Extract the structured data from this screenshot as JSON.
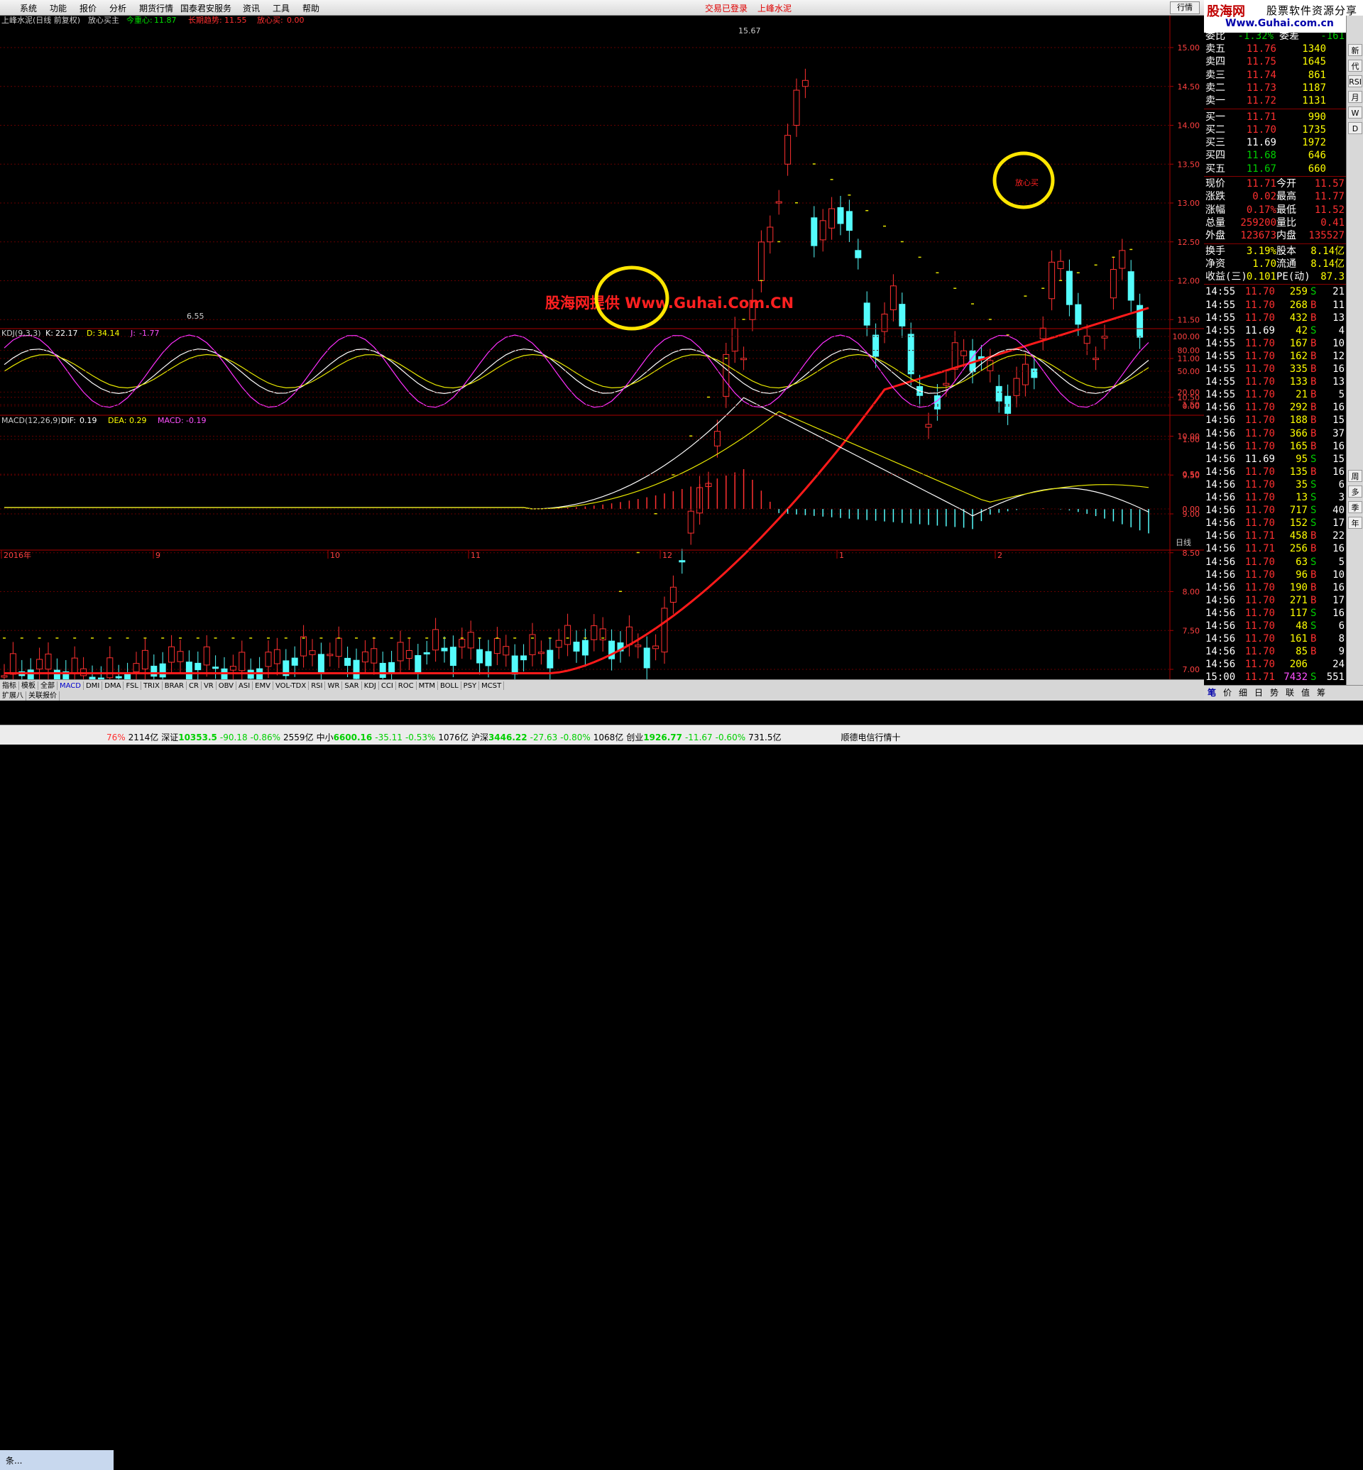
{
  "menu": [
    "系统",
    "功能",
    "报价",
    "分析",
    "期货行情",
    "国泰君安服务",
    "资讯",
    "工具",
    "帮助"
  ],
  "title_center": "交易已登录",
  "title_stock": "上峰水泥",
  "return_btn": "行情",
  "logo": {
    "brand": "股海网",
    "slogan": "股票软件资源分享",
    "url": "Www.Guhai.com.cn"
  },
  "main_header": {
    "name": "上峰水泥(日线 前复权)",
    "indicator": "放心买主",
    "l1": "今重心:",
    "v1": "11.87",
    "l2": "长期趋势:",
    "v2": "11.55",
    "l3": "放心买:",
    "v3": "0.00"
  },
  "price_axis": [
    "15.00",
    "14.50",
    "14.00",
    "13.50",
    "13.00",
    "12.50",
    "12.00",
    "11.50",
    "11.00",
    "10.50",
    "10.00",
    "9.50",
    "9.00",
    "8.50",
    "8.00",
    "7.50",
    "7.00"
  ],
  "annotations": {
    "high": "15.67",
    "low": "6.55",
    "signal": "放心买",
    "watermark": "股海网提供 Www.Guhai.Com.CN"
  },
  "kdj": {
    "name": "KDJ(9,3,3)",
    "k_label": "K:",
    "k": "22.17",
    "d_label": "D:",
    "d": "34.14",
    "j_label": "J:",
    "j": "-1.77",
    "axis": [
      "100.00",
      "80.00",
      "50.00",
      "20.00",
      "0.00"
    ]
  },
  "macd": {
    "name": "MACD(12,26,9)",
    "dif_label": "DIF:",
    "dif": "0.19",
    "dea_label": "DEA:",
    "dea": "0.29",
    "macd_label": "MACD:",
    "macd": "-0.19",
    "axis": [
      "1.50",
      "1.00",
      "0.50",
      "0.00"
    ]
  },
  "date_axis": [
    "2016年",
    "9",
    "10",
    "11",
    "12",
    "1",
    "2"
  ],
  "period": "日线",
  "tabs": [
    "指标",
    "模板",
    "全部",
    "MACD",
    "DMI",
    "DMA",
    "FSL",
    "TRIX",
    "BRAR",
    "CR",
    "VR",
    "OBV",
    "ASI",
    "EMV",
    "VOL-TDX",
    "RSI",
    "WR",
    "SAR",
    "KDJ",
    "CCI",
    "ROC",
    "MTM",
    "BOLL",
    "PSY",
    "MCST"
  ],
  "tabs2": [
    "扩展八",
    "关联报价"
  ],
  "quote": {
    "weibi": {
      "l": "委比",
      "v": "-1.32%",
      "l2": "委差",
      "v2": "-161"
    },
    "sell": [
      {
        "l": "卖五",
        "p": "11.76",
        "v": "1340"
      },
      {
        "l": "卖四",
        "p": "11.75",
        "v": "1645"
      },
      {
        "l": "卖三",
        "p": "11.74",
        "v": "861"
      },
      {
        "l": "卖二",
        "p": "11.73",
        "v": "1187"
      },
      {
        "l": "卖一",
        "p": "11.72",
        "v": "1131"
      }
    ],
    "buy": [
      {
        "l": "买一",
        "p": "11.71",
        "v": "990"
      },
      {
        "l": "买二",
        "p": "11.70",
        "v": "1735"
      },
      {
        "l": "买三",
        "p": "11.69",
        "v": "1972"
      },
      {
        "l": "买四",
        "p": "11.68",
        "v": "646"
      },
      {
        "l": "买五",
        "p": "11.67",
        "v": "660"
      }
    ],
    "stats": [
      {
        "l": "现价",
        "v": "11.71",
        "l2": "今开",
        "v2": "11.57"
      },
      {
        "l": "涨跌",
        "v": "0.02",
        "l2": "最高",
        "v2": "11.77"
      },
      {
        "l": "涨幅",
        "v": "0.17%",
        "l2": "最低",
        "v2": "11.52"
      },
      {
        "l": "总量",
        "v": "259200",
        "l2": "量比",
        "v2": "0.41"
      },
      {
        "l": "外盘",
        "v": "123673",
        "l2": "内盘",
        "v2": "135527"
      }
    ],
    "stats2": [
      {
        "l": "换手",
        "v": "3.19%",
        "l2": "股本",
        "v2": "8.14亿"
      },
      {
        "l": "净资",
        "v": "1.70",
        "l2": "流通",
        "v2": "8.14亿"
      },
      {
        "l": "收益(三)",
        "v": "0.101",
        "l2": "PE(动)",
        "v2": "87.3"
      }
    ],
    "ticks": [
      {
        "t": "14:55",
        "p": "11.70",
        "v": "259",
        "s": "S",
        "n": "21"
      },
      {
        "t": "14:55",
        "p": "11.70",
        "v": "268",
        "s": "B",
        "n": "11"
      },
      {
        "t": "14:55",
        "p": "11.70",
        "v": "432",
        "s": "B",
        "n": "13"
      },
      {
        "t": "14:55",
        "p": "11.69",
        "v": "42",
        "s": "S",
        "n": "4"
      },
      {
        "t": "14:55",
        "p": "11.70",
        "v": "167",
        "s": "B",
        "n": "10"
      },
      {
        "t": "14:55",
        "p": "11.70",
        "v": "162",
        "s": "B",
        "n": "12"
      },
      {
        "t": "14:55",
        "p": "11.70",
        "v": "335",
        "s": "B",
        "n": "16"
      },
      {
        "t": "14:55",
        "p": "11.70",
        "v": "133",
        "s": "B",
        "n": "13"
      },
      {
        "t": "14:55",
        "p": "11.70",
        "v": "21",
        "s": "B",
        "n": "5"
      },
      {
        "t": "14:56",
        "p": "11.70",
        "v": "292",
        "s": "B",
        "n": "16"
      },
      {
        "t": "14:56",
        "p": "11.70",
        "v": "188",
        "s": "B",
        "n": "15"
      },
      {
        "t": "14:56",
        "p": "11.70",
        "v": "366",
        "s": "B",
        "n": "37"
      },
      {
        "t": "14:56",
        "p": "11.70",
        "v": "165",
        "s": "B",
        "n": "16"
      },
      {
        "t": "14:56",
        "p": "11.69",
        "v": "95",
        "s": "S",
        "n": "15"
      },
      {
        "t": "14:56",
        "p": "11.70",
        "v": "135",
        "s": "B",
        "n": "16"
      },
      {
        "t": "14:56",
        "p": "11.70",
        "v": "35",
        "s": "S",
        "n": "6"
      },
      {
        "t": "14:56",
        "p": "11.70",
        "v": "13",
        "s": "S",
        "n": "3"
      },
      {
        "t": "14:56",
        "p": "11.70",
        "v": "717",
        "s": "S",
        "n": "40"
      },
      {
        "t": "14:56",
        "p": "11.70",
        "v": "152",
        "s": "S",
        "n": "17"
      },
      {
        "t": "14:56",
        "p": "11.71",
        "v": "458",
        "s": "B",
        "n": "22"
      },
      {
        "t": "14:56",
        "p": "11.71",
        "v": "256",
        "s": "B",
        "n": "16"
      },
      {
        "t": "14:56",
        "p": "11.70",
        "v": "63",
        "s": "S",
        "n": "5"
      },
      {
        "t": "14:56",
        "p": "11.70",
        "v": "96",
        "s": "B",
        "n": "10"
      },
      {
        "t": "14:56",
        "p": "11.70",
        "v": "190",
        "s": "B",
        "n": "16"
      },
      {
        "t": "14:56",
        "p": "11.70",
        "v": "271",
        "s": "B",
        "n": "17"
      },
      {
        "t": "14:56",
        "p": "11.70",
        "v": "117",
        "s": "S",
        "n": "16"
      },
      {
        "t": "14:56",
        "p": "11.70",
        "v": "48",
        "s": "S",
        "n": "6"
      },
      {
        "t": "14:56",
        "p": "11.70",
        "v": "161",
        "s": "B",
        "n": "8"
      },
      {
        "t": "14:56",
        "p": "11.70",
        "v": "85",
        "s": "B",
        "n": "9"
      },
      {
        "t": "14:56",
        "p": "11.70",
        "v": "206",
        "s": "",
        "n": "24"
      },
      {
        "t": "15:00",
        "p": "11.71",
        "v": "7432",
        "s": "S",
        "n": "551"
      }
    ]
  },
  "rtabs": [
    "笔",
    "价",
    "细",
    "日",
    "势",
    "联",
    "值",
    "筹"
  ],
  "vtools": [
    "新",
    "代",
    "RSI",
    "月",
    "W",
    "D",
    "周",
    "多",
    "季",
    "年"
  ],
  "ticker": [
    {
      "l": "深证",
      "v": "10353.5",
      "c": "-90.18",
      "p": "-0.86%",
      "a": "2559亿"
    },
    {
      "l": "中小",
      "v": "6600.16",
      "c": "-35.11",
      "p": "-0.53%",
      "a": "1076亿"
    },
    {
      "l": "沪深",
      "v": "3446.22",
      "c": "-27.63",
      "p": "-0.80%",
      "a": "1068亿"
    },
    {
      "l": "创业",
      "v": "1926.77",
      "c": "-11.67",
      "p": "-0.60%",
      "a": "731.5亿"
    }
  ],
  "ticker_head": {
    "p": "76%",
    "a": "2114亿"
  },
  "ticker_tail": "顺德电信行情十",
  "taskbar_item": "条..."
}
